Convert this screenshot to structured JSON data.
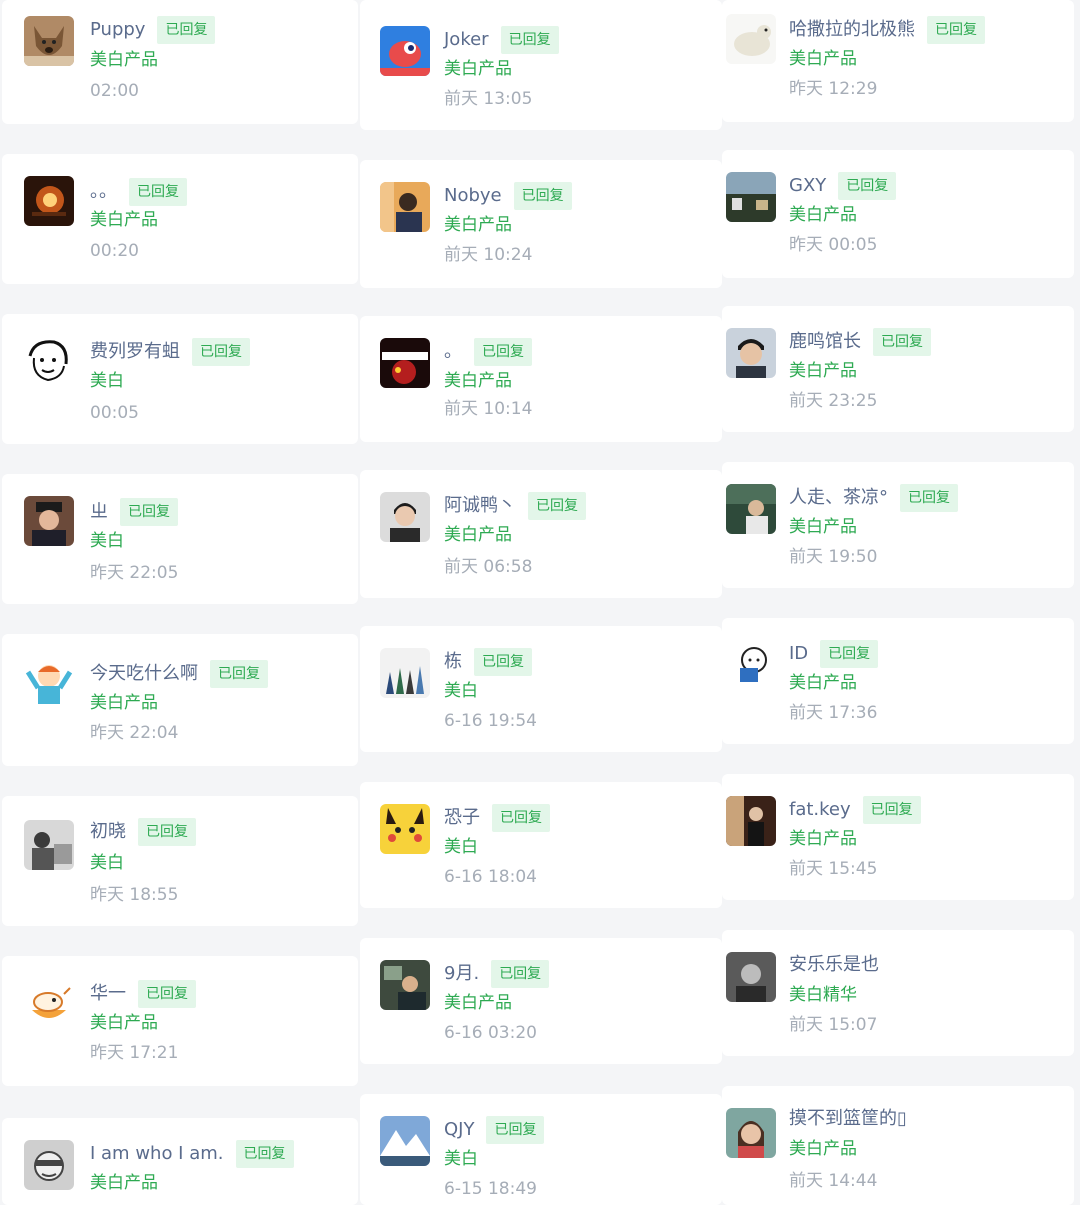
{
  "reply_badge_label": "已回复",
  "colors": {
    "name": "#5a6b8c",
    "product": "#2eaa52",
    "badge_bg": "#e3f6e9",
    "time": "#a6adb7",
    "page_bg": "#f4f5f7"
  },
  "columns": [
    {
      "cards": [
        {
          "name": "Puppy",
          "product": "美白产品",
          "time": "02:00",
          "replied": true,
          "avatar": "dog-avatar"
        },
        {
          "name": "。。",
          "product": "美白产品",
          "time": "00:20",
          "replied": true,
          "avatar": "lamp-avatar"
        },
        {
          "name": "费列罗有蛆",
          "product": "美白",
          "time": "00:05",
          "replied": true,
          "avatar": "cartoon-face-avatar"
        },
        {
          "name": "ㄓ",
          "product": "美白",
          "time": "昨天 22:05",
          "replied": true,
          "avatar": "person-hat-avatar"
        },
        {
          "name": "今天吃什么啊",
          "product": "美白产品",
          "time": "昨天 22:04",
          "replied": true,
          "avatar": "cartoon-kid-avatar"
        },
        {
          "name": "初晓",
          "product": "美白",
          "time": "昨天 18:55",
          "replied": true,
          "avatar": "photo-avatar"
        },
        {
          "name": "华一",
          "product": "美白产品",
          "time": "昨天 17:21",
          "replied": true,
          "avatar": "cartoon-animal-avatar"
        },
        {
          "name": "I am who I am.",
          "product": "美白产品",
          "time": "",
          "replied": true,
          "avatar": "sketch-face-avatar"
        }
      ]
    },
    {
      "cards": [
        {
          "name": "Joker",
          "product": "美白产品",
          "time": "前天 13:05",
          "replied": true,
          "avatar": "joker-avatar"
        },
        {
          "name": "Nobye",
          "product": "美白产品",
          "time": "前天 10:24",
          "replied": true,
          "avatar": "painting-avatar"
        },
        {
          "name": "。",
          "product": "美白产品",
          "time": "前天 10:14",
          "replied": true,
          "avatar": "red-text-avatar"
        },
        {
          "name": "阿诚鸭丶",
          "product": "美白产品",
          "time": "前天 06:58",
          "replied": true,
          "avatar": "portrait-avatar"
        },
        {
          "name": "栋",
          "product": "美白",
          "time": "6-16 19:54",
          "replied": true,
          "avatar": "pencils-avatar"
        },
        {
          "name": "恐子",
          "product": "美白",
          "time": "6-16 18:04",
          "replied": true,
          "avatar": "pikachu-avatar"
        },
        {
          "name": "9月.",
          "product": "美白产品",
          "time": "6-16 03:20",
          "replied": true,
          "avatar": "desk-avatar"
        },
        {
          "name": "QJY",
          "product": "美白",
          "time": "6-15 18:49",
          "replied": true,
          "avatar": "mountain-avatar"
        }
      ]
    },
    {
      "cards": [
        {
          "name": "哈撒拉的北极熊",
          "product": "美白产品",
          "time": "昨天 12:29",
          "replied": true,
          "avatar": "polar-bear-avatar"
        },
        {
          "name": "GXY",
          "product": "美白产品",
          "time": "昨天 00:05",
          "replied": true,
          "avatar": "landscape-avatar"
        },
        {
          "name": "鹿鸣馆长",
          "product": "美白产品",
          "time": "前天 23:25",
          "replied": true,
          "avatar": "young-man-avatar"
        },
        {
          "name": "人走、茶凉°",
          "product": "美白产品",
          "time": "前天 19:50",
          "replied": true,
          "avatar": "forest-person-avatar"
        },
        {
          "name": "ID",
          "product": "美白产品",
          "time": "前天 17:36",
          "replied": true,
          "avatar": "reading-doodle-avatar"
        },
        {
          "name": "fat.key",
          "product": "美白产品",
          "time": "前天 15:45",
          "replied": true,
          "avatar": "dark-figure-avatar"
        },
        {
          "name": "安乐乐是也",
          "product": "美白精华",
          "time": "前天 15:07",
          "replied": false,
          "avatar": "bw-portrait-avatar"
        },
        {
          "name": "摸不到篮筐的▯",
          "product": "美白产品",
          "time": "前天 14:44",
          "replied": false,
          "avatar": "girl-portrait-avatar"
        }
      ]
    }
  ]
}
